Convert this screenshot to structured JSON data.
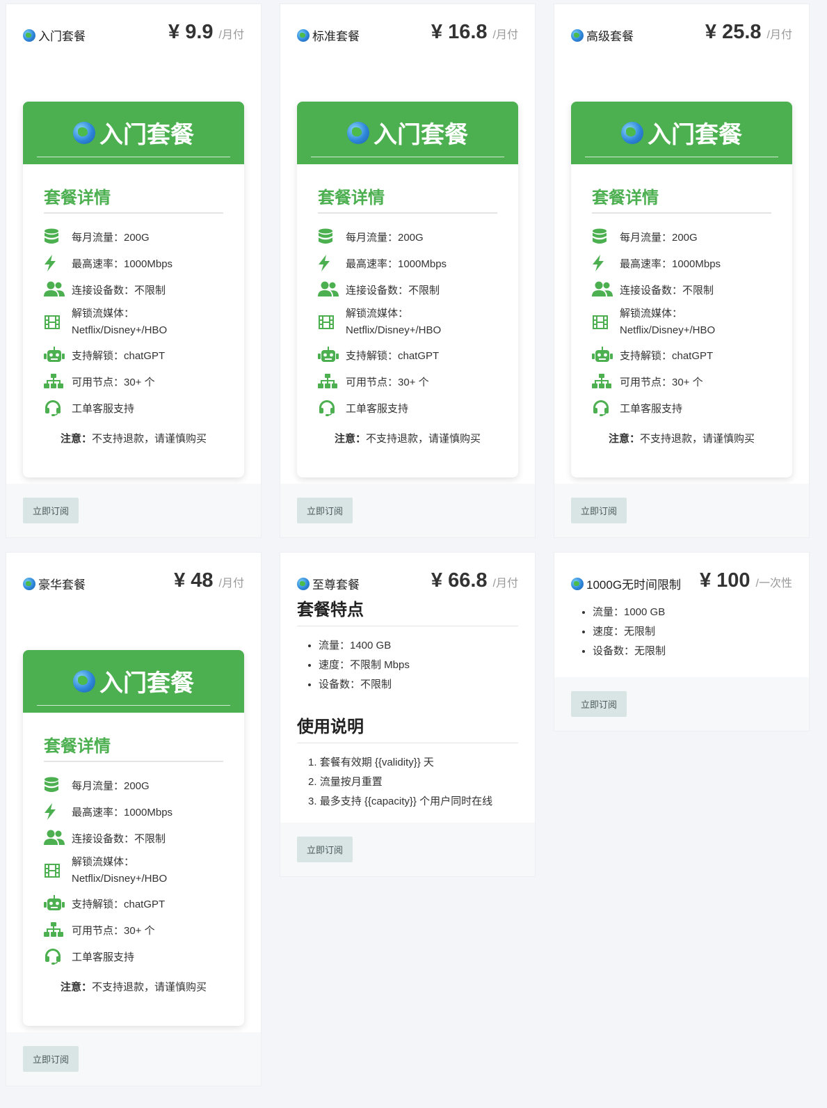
{
  "plans": [
    {
      "name": "入门套餐",
      "price": "¥ 9.9",
      "unit": "/月付",
      "banner": "入门套餐",
      "details_title": "套餐详情",
      "features": [
        {
          "icon": "database-icon",
          "text": "每月流量：200G"
        },
        {
          "icon": "lightning-icon",
          "text": "最高速率：1000Mbps"
        },
        {
          "icon": "users-icon",
          "text": "连接设备数：不限制"
        },
        {
          "icon": "film-icon",
          "text": "解锁流媒体：Netflix/Disney+/HBO"
        },
        {
          "icon": "robot-icon",
          "text": "支持解锁：chatGPT"
        },
        {
          "icon": "sitemap-icon",
          "text": "可用节点：30+ 个"
        },
        {
          "icon": "headset-icon",
          "text": "工单客服支持"
        }
      ],
      "note_label": "注意：",
      "note_text": "不支持退款，请谨慎购买",
      "button": "立即订阅"
    },
    {
      "name": "标准套餐",
      "price": "¥ 16.8",
      "unit": "/月付",
      "banner": "入门套餐",
      "details_title": "套餐详情",
      "features": [
        {
          "icon": "database-icon",
          "text": "每月流量：200G"
        },
        {
          "icon": "lightning-icon",
          "text": "最高速率：1000Mbps"
        },
        {
          "icon": "users-icon",
          "text": "连接设备数：不限制"
        },
        {
          "icon": "film-icon",
          "text": "解锁流媒体：Netflix/Disney+/HBO"
        },
        {
          "icon": "robot-icon",
          "text": "支持解锁：chatGPT"
        },
        {
          "icon": "sitemap-icon",
          "text": "可用节点：30+ 个"
        },
        {
          "icon": "headset-icon",
          "text": "工单客服支持"
        }
      ],
      "note_label": "注意：",
      "note_text": "不支持退款，请谨慎购买",
      "button": "立即订阅"
    },
    {
      "name": "高级套餐",
      "price": "¥ 25.8",
      "unit": "/月付",
      "banner": "入门套餐",
      "details_title": "套餐详情",
      "features": [
        {
          "icon": "database-icon",
          "text": "每月流量：200G"
        },
        {
          "icon": "lightning-icon",
          "text": "最高速率：1000Mbps"
        },
        {
          "icon": "users-icon",
          "text": "连接设备数：不限制"
        },
        {
          "icon": "film-icon",
          "text": "解锁流媒体：Netflix/Disney+/HBO"
        },
        {
          "icon": "robot-icon",
          "text": "支持解锁：chatGPT"
        },
        {
          "icon": "sitemap-icon",
          "text": "可用节点：30+ 个"
        },
        {
          "icon": "headset-icon",
          "text": "工单客服支持"
        }
      ],
      "note_label": "注意：",
      "note_text": "不支持退款，请谨慎购买",
      "button": "立即订阅"
    },
    {
      "name": "豪华套餐",
      "price": "¥ 48",
      "unit": "/月付",
      "banner": "入门套餐",
      "details_title": "套餐详情",
      "features": [
        {
          "icon": "database-icon",
          "text": "每月流量：200G"
        },
        {
          "icon": "lightning-icon",
          "text": "最高速率：1000Mbps"
        },
        {
          "icon": "users-icon",
          "text": "连接设备数：不限制"
        },
        {
          "icon": "film-icon",
          "text": "解锁流媒体：Netflix/Disney+/HBO"
        },
        {
          "icon": "robot-icon",
          "text": "支持解锁：chatGPT"
        },
        {
          "icon": "sitemap-icon",
          "text": "可用节点：30+ 个"
        },
        {
          "icon": "headset-icon",
          "text": "工单客服支持"
        }
      ],
      "note_label": "注意：",
      "note_text": "不支持退款，请谨慎购买",
      "button": "立即订阅"
    },
    {
      "name": "至尊套餐",
      "price": "¥ 66.8",
      "unit": "/月付",
      "features_title": "套餐特点",
      "features": [
        "流量：1400 GB",
        "速度：不限制 Mbps",
        "设备数：不限制"
      ],
      "usage_title": "使用说明",
      "usage": [
        "套餐有效期 {{validity}} 天",
        "流量按月重置",
        "最多支持 {{capacity}} 个用户同时在线"
      ],
      "button": "立即订阅"
    },
    {
      "name": "1000G无时间限制",
      "price": "¥ 100",
      "unit": "/一次性",
      "features": [
        "流量：1000 GB",
        "速度：无限制",
        "设备数：无限制"
      ],
      "button": "立即订阅"
    }
  ],
  "colors": {
    "accent": "#4caf50",
    "button_bg": "#d9e4e4",
    "page_bg": "#f3f5f9"
  }
}
